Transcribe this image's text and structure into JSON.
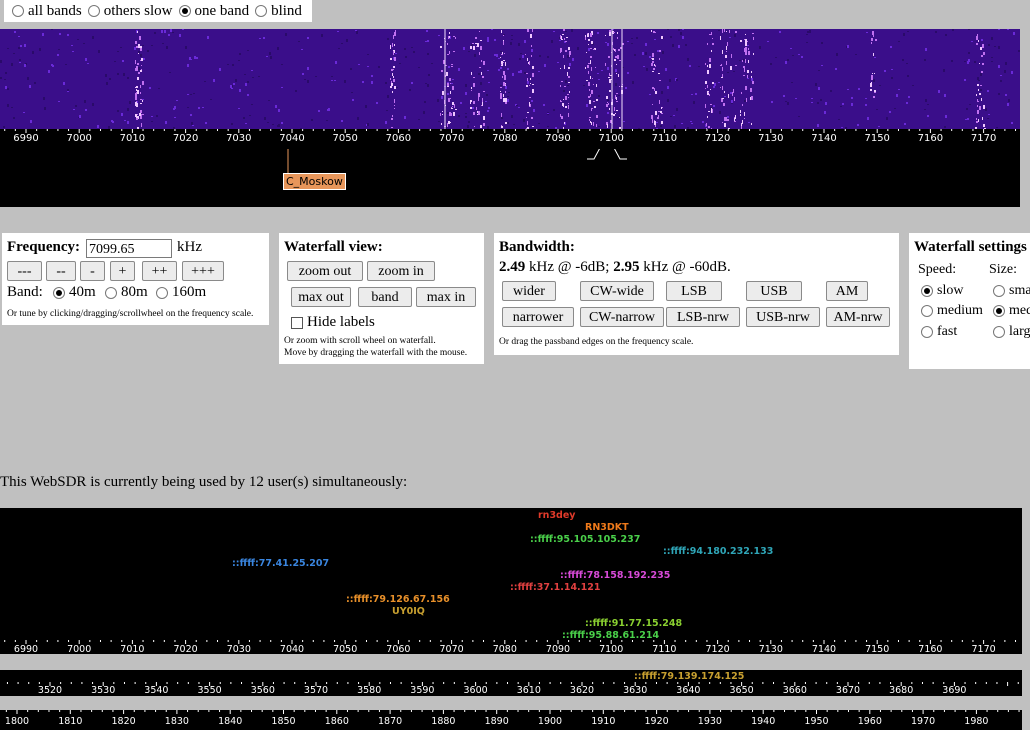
{
  "modes": [
    {
      "label": "all bands",
      "checked": false
    },
    {
      "label": "others slow",
      "checked": false
    },
    {
      "label": "one band",
      "checked": true
    },
    {
      "label": "blind",
      "checked": false
    }
  ],
  "scale_40m": {
    "start": 6990,
    "step": 10,
    "labels": [
      "6990",
      "7000",
      "7010",
      "7020",
      "7030",
      "7040",
      "7050",
      "7060",
      "7070",
      "7080",
      "7090",
      "7100",
      "7110",
      "7120",
      "7130",
      "7140",
      "7150",
      "7160",
      "7170"
    ]
  },
  "scale_80m": {
    "labels": [
      "3520",
      "3530",
      "3540",
      "3550",
      "3560",
      "3570",
      "3580",
      "3590",
      "3600",
      "3610",
      "3620",
      "3630",
      "3640",
      "3650",
      "3660",
      "3670",
      "3680",
      "3690"
    ]
  },
  "scale_160m": {
    "labels": [
      "1800",
      "1810",
      "1820",
      "1830",
      "1840",
      "1850",
      "1860",
      "1870",
      "1880",
      "1890",
      "1900",
      "1910",
      "1920",
      "1930",
      "1940",
      "1950",
      "1960",
      "1970",
      "1980"
    ]
  },
  "waterfall": {
    "bg_color": "#3a0e8a",
    "label_tag": "C_Moskow"
  },
  "frequency": {
    "title": "Frequency:",
    "value": "7099.65",
    "unit": "kHz",
    "step_buttons": [
      "---",
      "--",
      "-",
      "+",
      "++",
      "+++"
    ],
    "band_label": "Band:",
    "bands": [
      {
        "label": "40m",
        "checked": true
      },
      {
        "label": "80m",
        "checked": false
      },
      {
        "label": "160m",
        "checked": false
      }
    ],
    "hint": "Or tune by clicking/dragging/scrollwheel on the frequency scale."
  },
  "waterfall_view": {
    "title": "Waterfall view:",
    "zoom_out": "zoom out",
    "zoom_in": "zoom in",
    "max_out": "max out",
    "band": "band",
    "max_in": "max in",
    "hide_labels": "Hide labels",
    "hint1": "Or zoom with scroll wheel on waterfall.",
    "hint2": "Move by dragging the waterfall with the mouse."
  },
  "bandwidth": {
    "title": "Bandwidth:",
    "bw6": "2.49",
    "bw6_suffix": " kHz @ -6dB; ",
    "bw60": "2.95",
    "bw60_suffix": " kHz @ -60dB.",
    "row1": [
      "wider",
      "CW-wide",
      "LSB",
      "USB",
      "AM"
    ],
    "row2": [
      "narrower",
      "CW-narrow",
      "LSB-nrw",
      "USB-nrw",
      "AM-nrw"
    ],
    "hint": "Or drag the passband edges on the frequency scale."
  },
  "waterfall_settings": {
    "title": "Waterfall settings",
    "speed_label": "Speed:",
    "size_label": "Size:",
    "speeds": [
      {
        "label": "slow",
        "checked": true
      },
      {
        "label": "medium",
        "checked": false
      },
      {
        "label": "fast",
        "checked": false
      }
    ],
    "sizes": [
      {
        "label": "small",
        "checked": false
      },
      {
        "label": "medium",
        "checked": true
      },
      {
        "label": "large",
        "checked": false
      }
    ]
  },
  "users": {
    "text": "This WebSDR is currently being used by 12 user(s) simultaneously:",
    "list": [
      {
        "name": "rn3dey",
        "color": "#e03a2a"
      },
      {
        "name": "RN3DKT",
        "color": "#f07a1a"
      },
      {
        "name": "::ffff:95.105.105.237",
        "color": "#4ad04a"
      },
      {
        "name": "::ffff:94.180.232.133",
        "color": "#2fa6b8"
      },
      {
        "name": "::ffff:77.41.25.207",
        "color": "#3a86e0"
      },
      {
        "name": "::ffff:78.158.192.235",
        "color": "#d84ad8"
      },
      {
        "name": "::ffff:37.1.14.121",
        "color": "#e04040"
      },
      {
        "name": "::ffff:79.126.67.156",
        "color": "#e8902a"
      },
      {
        "name": "UY0IQ",
        "color": "#c8a030"
      },
      {
        "name": "::ffff:91.77.15.248",
        "color": "#8ad030"
      },
      {
        "name": "::ffff:95.88.61.214",
        "color": "#4ad04a"
      },
      {
        "name": "::ffff:79.139.174.125",
        "color": "#c8a030"
      }
    ]
  }
}
